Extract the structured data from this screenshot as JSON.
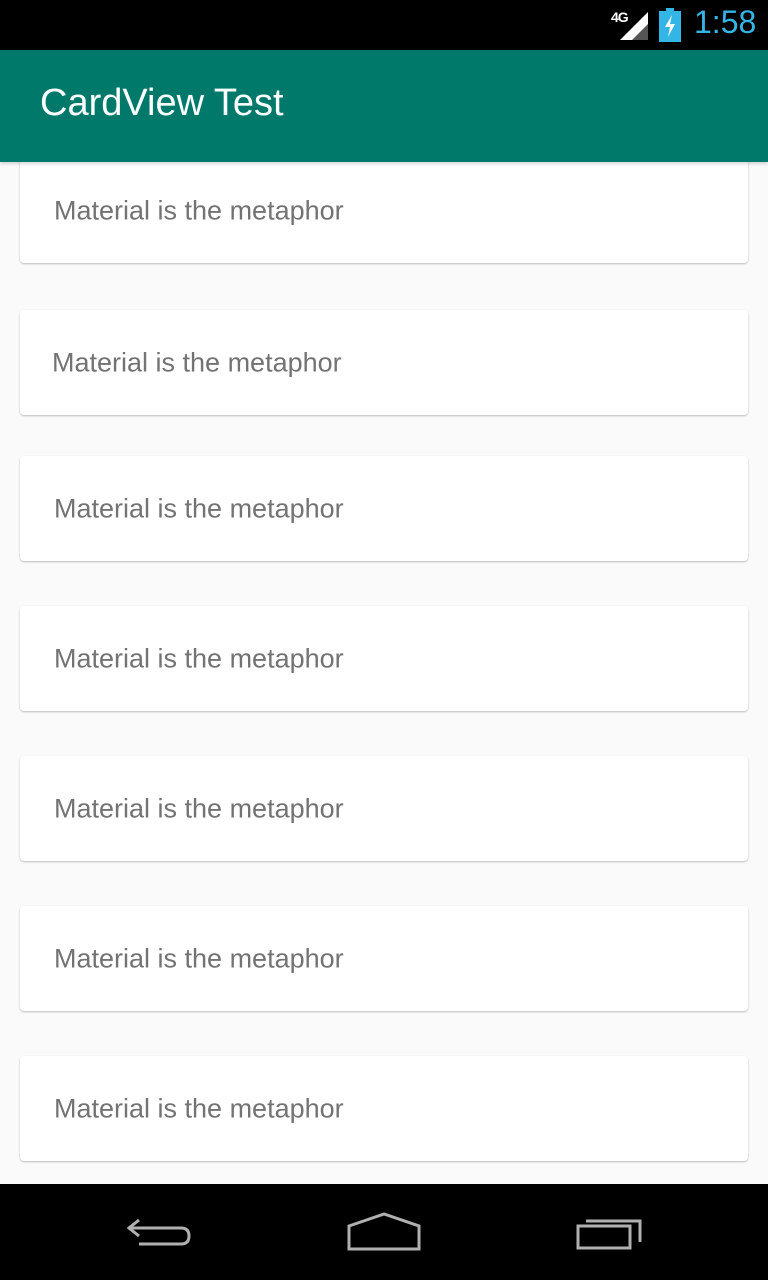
{
  "status_bar": {
    "network": "4G",
    "time": "1:58",
    "icons": [
      "signal-icon",
      "battery-charging-icon"
    ],
    "time_color": "#33b5e5"
  },
  "app_bar": {
    "title": "CardView Test",
    "color": "#00796b"
  },
  "cards": [
    {
      "text": "Material is the metaphor"
    },
    {
      "text": "Material is the metaphor"
    },
    {
      "text": "Material is the metaphor"
    },
    {
      "text": "Material is the metaphor"
    },
    {
      "text": "Material is the metaphor"
    },
    {
      "text": "Material is the metaphor"
    },
    {
      "text": "Material is the metaphor"
    }
  ],
  "nav_bar": {
    "icons": [
      "back-icon",
      "home-icon",
      "recent-apps-icon"
    ]
  }
}
